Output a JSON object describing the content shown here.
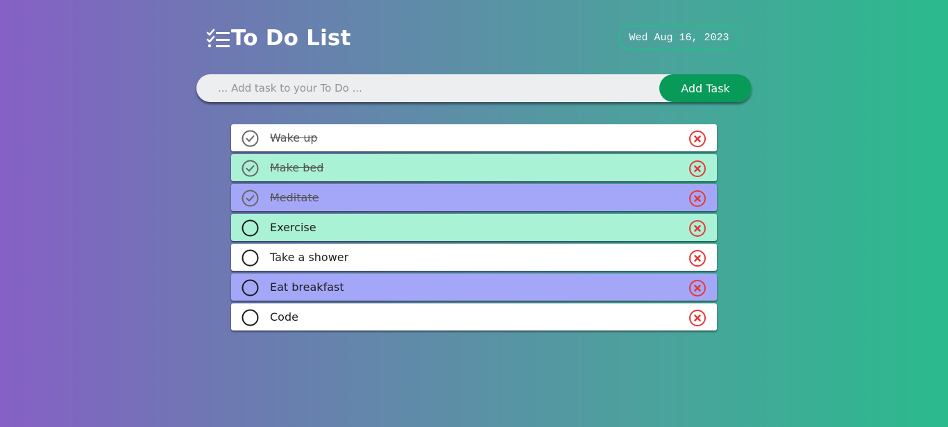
{
  "app": {
    "title": "To Do List",
    "title_icon": "checklist-icon",
    "date": "Wed Aug 16, 2023"
  },
  "input": {
    "placeholder": "... Add task to your To Do ...",
    "value": "",
    "add_label": "Add Task"
  },
  "colors": {
    "accent": "#079a58",
    "date_border": "#2bba8c",
    "delete": "#e53935",
    "row_white": "#ffffff",
    "row_green": "#aaf2d6",
    "row_purple": "#a4a7f8"
  },
  "tasks": [
    {
      "text": "Wake up",
      "done": true,
      "color": "white"
    },
    {
      "text": "Make bed",
      "done": true,
      "color": "green"
    },
    {
      "text": "Meditate",
      "done": true,
      "color": "purple"
    },
    {
      "text": "Exercise",
      "done": false,
      "color": "green"
    },
    {
      "text": "Take a shower",
      "done": false,
      "color": "white"
    },
    {
      "text": "Eat breakfast",
      "done": false,
      "color": "purple"
    },
    {
      "text": "Code",
      "done": false,
      "color": "white"
    }
  ]
}
